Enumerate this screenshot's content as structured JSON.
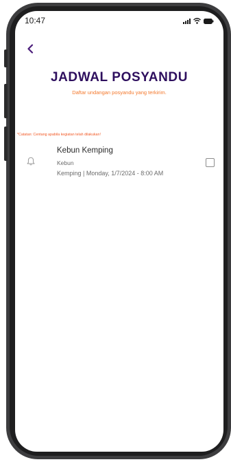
{
  "status_bar": {
    "time": "10:47",
    "icons": [
      "signal-icon",
      "wifi-icon",
      "battery-icon"
    ]
  },
  "header": {
    "back_icon": "chevron-left-icon",
    "title": "JADWAL POSYANDU",
    "subtitle": "Daftar undangan posyandu yang terkirim."
  },
  "note": "*Catatan: Centang apabila kegiatan telah dilakukan!",
  "schedule": [
    {
      "icon": "bell-icon",
      "title": "Kebun Kemping",
      "location": "Kebun",
      "meta": "Kemping |  Monday, 1/7/2024 - 8:00 AM",
      "checked": false
    }
  ],
  "colors": {
    "title": "#2e0f5e",
    "accent": "#f4772a",
    "note": "#f25a26",
    "back": "#4a1c7a"
  }
}
